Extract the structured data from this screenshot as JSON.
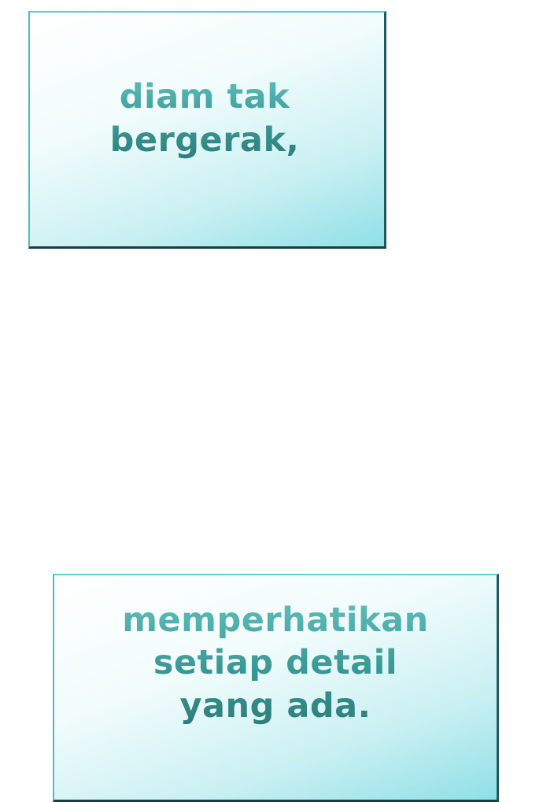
{
  "panels": [
    {
      "lines": [
        "diam tak",
        "bergerak,"
      ]
    },
    {
      "lines": [
        "memperhatikan",
        "setiap detail",
        "yang ada."
      ]
    }
  ],
  "colors": {
    "text": "#3a9894",
    "box_gradient_light": "#ffffff",
    "box_gradient_dark": "#8fe0e6",
    "border_light": "#5ccfd2",
    "border_dark": "#163f41",
    "page_background": "#ffffff"
  }
}
